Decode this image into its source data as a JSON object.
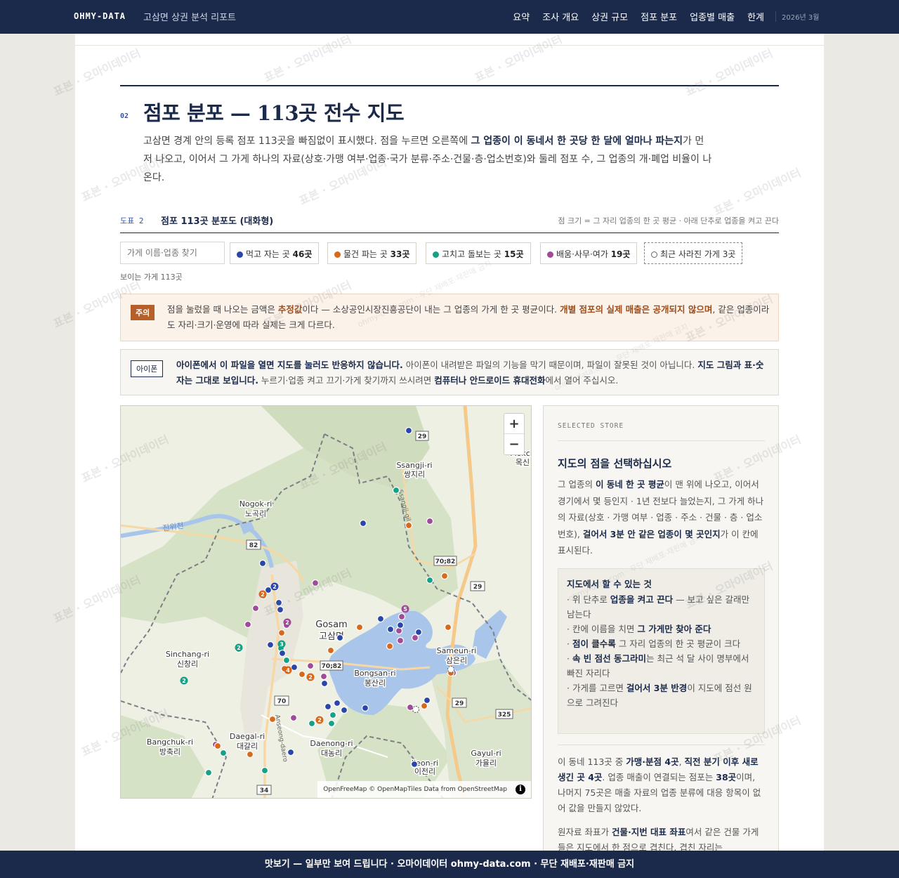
{
  "topbar": {
    "brand": "OHMY-DATA",
    "report_title": "고삼면 상권 분석 리포트",
    "nav": [
      "요약",
      "조사 개요",
      "상권 규모",
      "점포 분포",
      "업종별 매출",
      "한계"
    ],
    "date": "2026년 3월"
  },
  "section": {
    "number": "02",
    "title": "점포 분포 — 113곳 전수 지도",
    "intro_1": "고삼면 경계 안의 등록 점포 113곳을 빠짐없이 표시했다. 점을 누르면 오른쪽에 ",
    "intro_bold": "그 업종이 이 동네서 한 곳당 한 달에 얼마나 파는지",
    "intro_2": "가 먼저 나오고, 이어서 그 가게 하나의 자료(상호·가맹 여부·업종·국가 분류·주소·건물·층·업소번호)와 둘레 점포 수, 그 업종의 개·폐업 비율이 나온다."
  },
  "figure": {
    "number": "도표 2",
    "title": "점포 113곳 분포도 (대화형)",
    "note": "점 크기 = 그 자리 업종의 한 곳 평균 · 아래 단추로 업종을 켜고 끈다"
  },
  "filters": {
    "search_placeholder": "가게 이름·업종 찾기",
    "chips": [
      {
        "label": "먹고 자는 곳",
        "count": "46곳",
        "color": "#2a46a8"
      },
      {
        "label": "물건 파는 곳",
        "count": "33곳",
        "color": "#d8681a"
      },
      {
        "label": "고치고 돌보는 곳",
        "count": "15곳",
        "color": "#16a085"
      },
      {
        "label": "배움·사무·여가",
        "count": "19곳",
        "color": "#a04a9a"
      }
    ],
    "closed_chip": "최근 사라진 가게 3곳",
    "visible_count": "보이는 가게 113곳"
  },
  "warning": {
    "tag": "주의",
    "text_1": "점을 눌렀을 때 나오는 금액은 ",
    "bold_1": "추정값",
    "text_2": "이다 — 소상공인시장진흥공단이 내는 그 업종의 가게 한 곳 평균이다. ",
    "bold_2": "개별 점포의 실제 매출은 공개되지 않으며",
    "text_3": ", 같은 업종이라도 자리·크기·운영에 따라 실제는 크게 다르다."
  },
  "ios_notice": {
    "tag": "아이폰",
    "bold_1": "아이폰에서 이 파일을 열면 지도를 눌러도 반응하지 않습니다.",
    "text_1": " 아이폰이 내려받은 파일의 기능을 막기 때문이며, 파일이 잘못된 것이 아닙니다. ",
    "bold_2": "지도 그림과 표·숫자는 그대로 보입니다.",
    "text_2": " 누르기·업종 켜고 끄기·가게 찾기까지 쓰시려면 ",
    "bold_3": "컴퓨터나 안드로이드 휴대전화",
    "text_3": "에서 열어 주십시오."
  },
  "map": {
    "place_labels": [
      {
        "en": "Ssangji-ri",
        "ko": "쌍지리"
      },
      {
        "en": "Nogok-ri",
        "ko": "노곡리"
      },
      {
        "en": "Gosam",
        "ko": "고삼면"
      },
      {
        "en": "Sinchang-ri",
        "ko": "신창리"
      },
      {
        "en": "Sameun-ri",
        "ko": "삼은리"
      },
      {
        "en": "Bongsan-ri",
        "ko": "봉산리"
      },
      {
        "en": "Daegal-ri",
        "ko": "대갈리"
      },
      {
        "en": "Bangchuk-ri",
        "ko": "방축리"
      },
      {
        "en": "Daenong-ri",
        "ko": "대농리"
      },
      {
        "en": "Ijeon-ri",
        "ko": "이전리"
      },
      {
        "en": "Gayul-ri",
        "ko": "가율리"
      },
      {
        "en": "Mokch",
        "ko": "목신"
      }
    ],
    "river_label": "진위천",
    "road_labels": [
      "29",
      "82",
      "70;82",
      "29",
      "70;82",
      "70",
      "29",
      "325",
      "34"
    ],
    "road_name": "Anseong-daero",
    "road_name2": "Ssangji-gil",
    "zoom_in": "+",
    "zoom_out": "−",
    "attribution": "OpenFreeMap © OpenMapTiles Data from OpenStreetMap",
    "info": "i"
  },
  "panel": {
    "kicker": "SELECTED STORE",
    "title": "지도의 점을 선택하십시오",
    "desc_1": "그 업종의 ",
    "desc_b1": "이 동네 한 곳 평균",
    "desc_2": "이 맨 위에 나오고, 이어서 경기에서 몇 등인지 · 1년 전보다 늘었는지, 그 가게 하나의 자료(상호 · 가맹 여부 · 업종 · 주소 · 건물 · 층 · 업소번호), ",
    "desc_b2": "걸어서 3분 안 같은 업종이 몇 곳인지",
    "desc_3": "가 이 칸에 표시된다.",
    "howto_title": "지도에서 할 수 있는 것",
    "howto_items": [
      {
        "pre": "· 위 단추로 ",
        "bold": "업종을 켜고 끈다",
        "post": " — 보고 싶은 갈래만 남는다"
      },
      {
        "pre": "· 칸에 이름을 치면 ",
        "bold": "그 가게만 찾아 준다",
        "post": ""
      },
      {
        "pre": "· ",
        "bold": "점이 클수록",
        "post": " 그 자리 업종의 한 곳 평균이 크다"
      },
      {
        "pre": "· ",
        "bold": "속 빈 점선 동그라미",
        "post": "는 최근 석 달 사이 명부에서 빠진 자리다"
      },
      {
        "pre": "· 가게를 고르면 ",
        "bold": "걸어서 3분 반경",
        "post": "이 지도에 점선 원으로 그려진다"
      }
    ],
    "stats_1": "이 동네 113곳 중 ",
    "stats_b1": "가맹·분점 4곳",
    "stats_2": ", ",
    "stats_b2": "직전 분기 이후 새로 생긴 곳 4곳",
    "stats_3": ". 업종 매출이 연결되는 점포는 ",
    "stats_b3": "38곳",
    "stats_4": "이며, 나머지 75곳은 매출 자료의 업종 분류에 대응 항목이 없어 값을 만들지 않았다.",
    "coords_1": "원자료 좌표가 ",
    "coords_b1": "건물·지번 대표 좌표",
    "coords_2": "여서 같은 건물 가게들은 지도에서 한 점으로 겹친다. 겹친 자리는"
  },
  "watermark": {
    "text": "표본 · 오마이데이터",
    "sub": "ohmy-data.com · 무단 재배포·재판매 금지"
  },
  "footer": "맛보기 — 일부만 보여 드립니다 · 오마이데이터 ohmy-data.com · 무단 재배포·재판매 금지",
  "colors": {
    "navy": "#1b2a4a",
    "food": "#2a46a8",
    "retail": "#d8681a",
    "service": "#16a085",
    "office": "#a04a9a",
    "warn": "#b55f2a"
  }
}
